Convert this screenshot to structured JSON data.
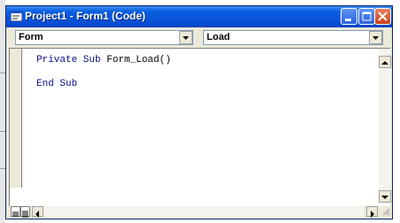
{
  "window": {
    "title": "Project1 - Form1 (Code)"
  },
  "object_combo": {
    "value": "Form"
  },
  "procedure_combo": {
    "value": "Load"
  },
  "code": {
    "lines": [
      {
        "keyword": "Private Sub ",
        "ident": "Form_Load()"
      },
      {
        "keyword": "End Sub",
        "ident": ""
      }
    ]
  },
  "icons": {
    "title_icon": "code-window-icon",
    "minimize": "minimize-icon",
    "maximize": "maximize-icon",
    "close": "close-icon",
    "dropdown": "chevron-down-icon",
    "scroll_up": "arrow-up-icon",
    "scroll_down": "arrow-down-icon",
    "scroll_left": "arrow-left-icon",
    "scroll_right": "arrow-right-icon",
    "procedure_view": "procedure-view-icon",
    "full_module_view": "full-module-view-icon"
  },
  "colors": {
    "titlebar": "#0651d9",
    "keyword": "#0a0a8c",
    "close_button": "#c93e1c"
  }
}
